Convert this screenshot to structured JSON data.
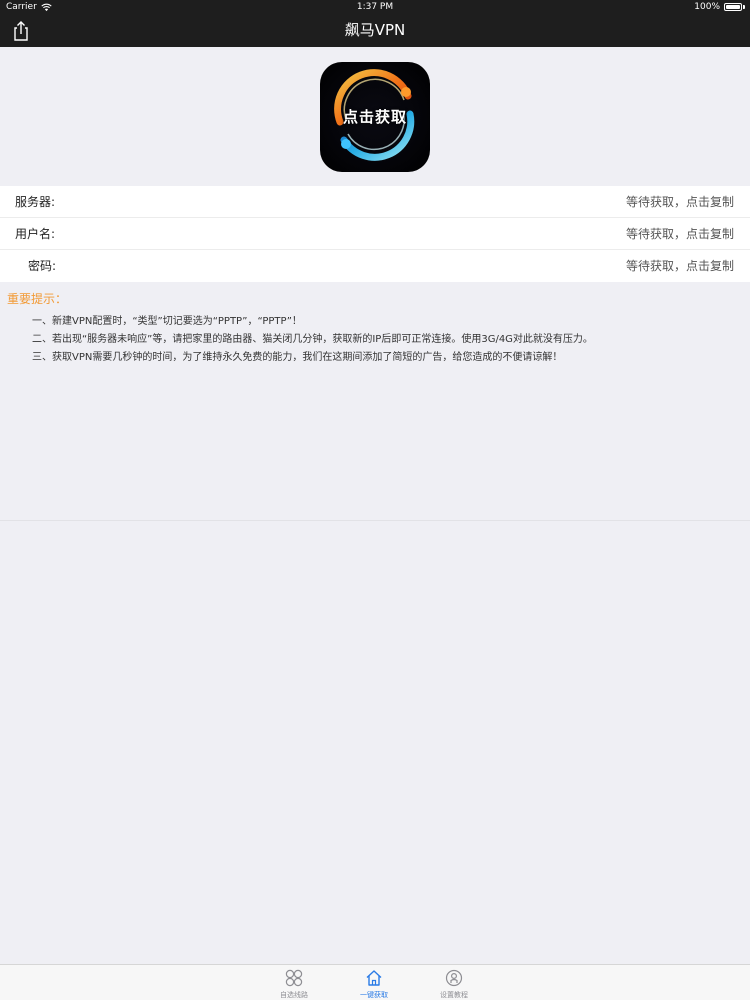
{
  "status_bar": {
    "carrier": "Carrier",
    "time": "1:37 PM",
    "battery": "100%"
  },
  "nav": {
    "title": "飙马VPN",
    "share_icon": "share-icon"
  },
  "logo": {
    "label": "点击获取"
  },
  "info": [
    {
      "label": "服务器:",
      "value": "等待获取，点击复制"
    },
    {
      "label": "用户名:",
      "value": "等待获取，点击复制"
    },
    {
      "label": "密码:",
      "value": "等待获取，点击复制"
    }
  ],
  "notes": {
    "title": "重要提示：",
    "lines": [
      "一、新建VPN配置时，“类型”切记要选为“PPTP”，“PPTP”！",
      "二、若出现“服务器未响应”等，请把家里的路由器、猫关闭几分钟，获取新的IP后即可正常连接。使用3G/4G对此就没有压力。",
      "三、获取VPN需要几秒钟的时间，为了维持永久免费的能力，我们在这期间添加了简短的广告，给您造成的不便请谅解！"
    ]
  },
  "tabs": [
    {
      "label": "自选线路",
      "icon": "grid-icon",
      "active": false
    },
    {
      "label": "一键获取",
      "icon": "home-icon",
      "active": true
    },
    {
      "label": "设置教程",
      "icon": "tutorial-icon",
      "active": false
    }
  ],
  "colors": {
    "nav_background": "#1e1e1e",
    "notes_title": "#f29a35",
    "tab_active": "#2a7be6"
  }
}
